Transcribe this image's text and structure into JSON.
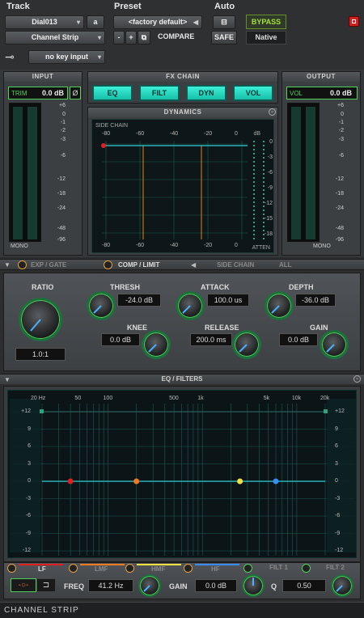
{
  "header": {
    "track_label": "Track",
    "preset_label": "Preset",
    "auto_label": "Auto",
    "track_name": "Dial013",
    "track_channel": "a",
    "plugin_name": "Channel Strip",
    "preset_name": "<factory default>",
    "minus": "-",
    "plus": "+",
    "compare": "COMPARE",
    "safe": "SAFE",
    "bypass": "BYPASS",
    "native": "Native",
    "key_input": "no key input"
  },
  "input": {
    "title": "INPUT",
    "trim_label": "TRIM",
    "trim_value": "0.0 dB",
    "phase": "Ø",
    "mono": "MONO",
    "scale": [
      "+6",
      "0",
      "-1",
      "-2",
      "-3",
      "-6",
      "-12",
      "-18",
      "-24",
      "-48",
      "-96"
    ]
  },
  "fx_chain": {
    "title": "FX CHAIN",
    "buttons": [
      "EQ",
      "FILT",
      "DYN",
      "VOL"
    ]
  },
  "output": {
    "title": "OUTPUT",
    "vol_label": "VOL",
    "vol_value": "0.0 dB",
    "mono": "MONO",
    "scale": [
      "+6",
      "0",
      "-1",
      "-2",
      "-3",
      "-6",
      "-12",
      "-18",
      "-24",
      "-48",
      "-96"
    ]
  },
  "dynamics": {
    "title": "DYNAMICS",
    "side_chain": "SIDE CHAIN",
    "db_label": "dB",
    "atten": "ATTEN",
    "top_ticks": [
      "-80",
      "-60",
      "-40",
      "-20",
      "0"
    ],
    "bottom_ticks": [
      "-80",
      "-60",
      "-40",
      "-20",
      "0"
    ],
    "right_ticks": [
      "0",
      "-3",
      "-6",
      "-9",
      "-12",
      "-15",
      "-18"
    ],
    "tabs": [
      "EXP / GATE",
      "COMP / LIMIT",
      "SIDE CHAIN",
      "ALL"
    ],
    "ratio_label": "RATIO",
    "ratio_value": "1.0:1",
    "thresh_label": "THRESH",
    "thresh_value": "-24.0 dB",
    "attack_label": "ATTACK",
    "attack_value": "100.0 us",
    "depth_label": "DEPTH",
    "depth_value": "-36.0 dB",
    "knee_label": "KNEE",
    "knee_value": "0.0 dB",
    "release_label": "RELEASE",
    "release_value": "200.0 ms",
    "gain_label": "GAIN",
    "gain_value": "0.0 dB"
  },
  "eq": {
    "title": "EQ / FILTERS",
    "freq_ticks": [
      "20 Hz",
      "50",
      "100",
      "500",
      "1k",
      "5k",
      "10k",
      "20k"
    ],
    "db_ticks": [
      "+12",
      "9",
      "6",
      "3",
      "0",
      "-3",
      "-6",
      "-9",
      "-12"
    ],
    "node_colors": [
      "#e02020",
      "#f07a20",
      "#f0e040",
      "#3a8cf0"
    ],
    "bands": [
      "LF",
      "LMF",
      "HMF",
      "HF",
      "FILT 1",
      "FILT 2"
    ],
    "freq_label": "FREQ",
    "freq_value": "41.2 Hz",
    "gain_label": "GAIN",
    "gain_value": "0.0 dB",
    "q_label": "Q",
    "q_value": "0.50"
  },
  "footer": {
    "title": "CHANNEL STRIP"
  }
}
